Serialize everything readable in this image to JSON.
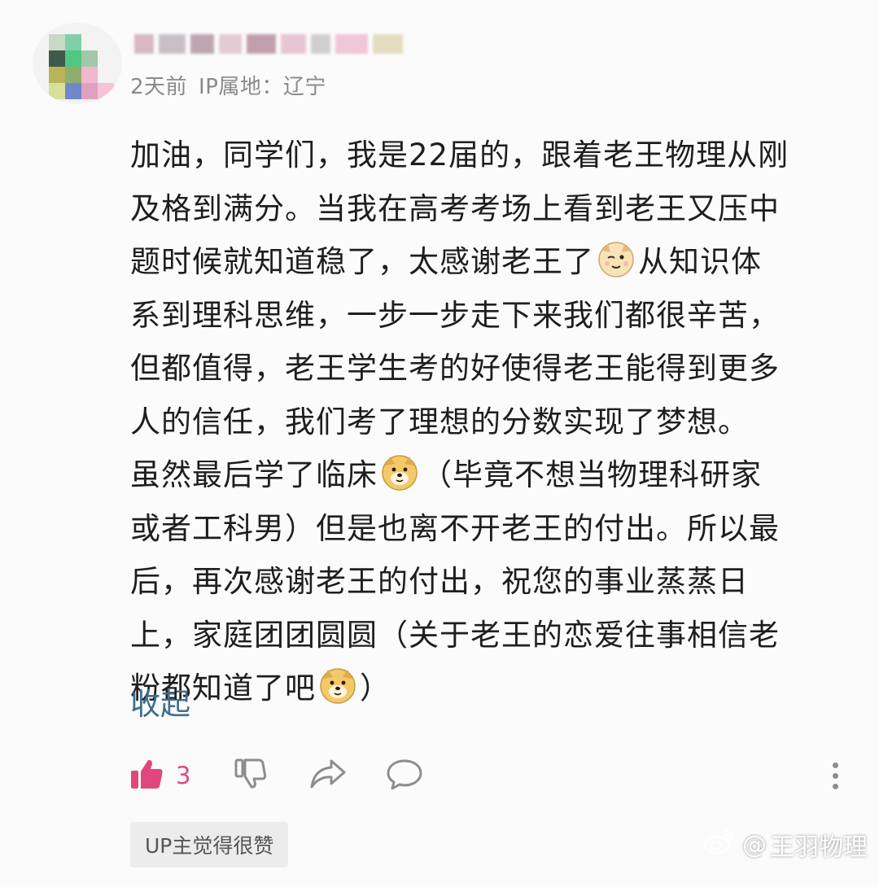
{
  "user": {
    "name": "",
    "time": "2天前",
    "ip_label": "IP属地：辽宁"
  },
  "comment": {
    "lines": [
      "加油，同学们，我是22届的，跟着老王物理从刚",
      "及格到满分。当我在高考考场上看到老王又压中",
      [
        "题时候就知道稳了，太感谢老王了",
        "从知识体"
      ],
      "系到理科思维，一步一步走下来我们都很辛苦，",
      "但都值得，老王学生考的好使得老王能得到更多",
      "人的信任，我们考了理想的分数实现了梦想。",
      [
        "虽然最后学了临床",
        "（毕竟不想当物理科研家"
      ],
      "或者工科男）但是也离不开老王的付出。所以最",
      "后，再次感谢老王的付出，祝您的事业蒸蒸日",
      "上，家庭团团圆圆（关于老王的恋爱往事相信老",
      [
        "粉都知道了吧",
        "）"
      ]
    ],
    "emojis": [
      "wink-cat-emoji",
      "doge-emoji",
      "doge-emoji"
    ],
    "collapse_label": "收起"
  },
  "actions": {
    "like_count": "3",
    "like_icon": "thumbs-up-icon",
    "dislike_icon": "thumbs-down-icon",
    "share_icon": "share-icon",
    "reply_icon": "comment-icon",
    "more_icon": "more-vertical-icon"
  },
  "badge": {
    "label": "UP主觉得很赞"
  },
  "watermark": {
    "at": "@",
    "name": "王羽物理"
  },
  "colors": {
    "like": "#e0487d",
    "link": "#3d6f8c",
    "meta": "#8a8a8a",
    "badge_bg": "#ececec"
  }
}
